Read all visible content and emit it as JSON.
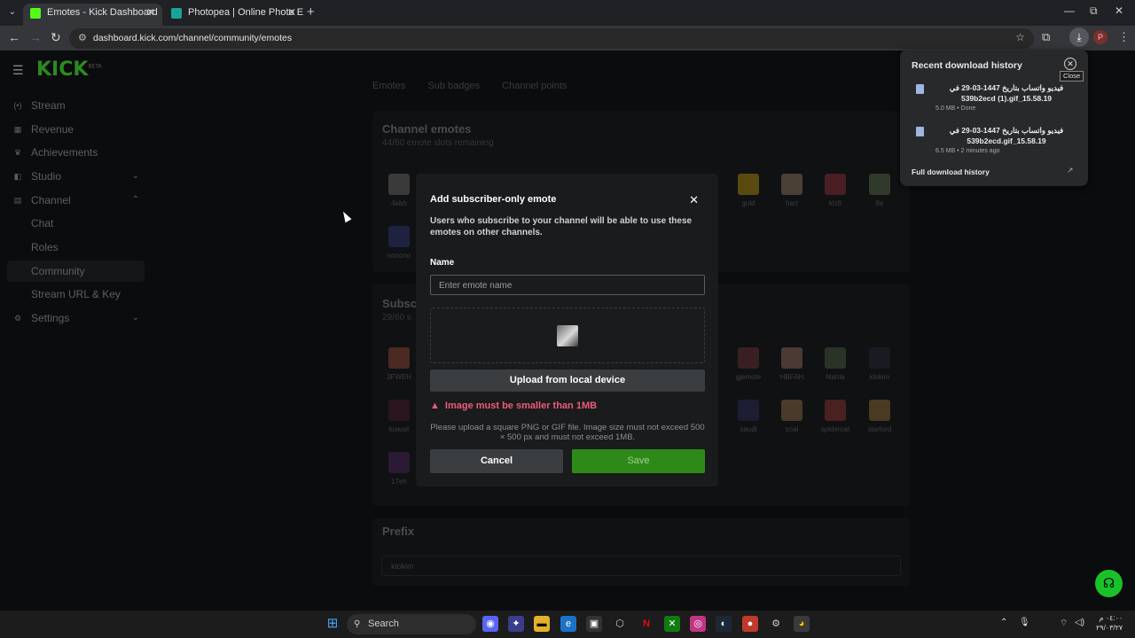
{
  "browser": {
    "tabs": [
      {
        "title": "Emotes - Kick Dashboard",
        "favicon_color": "#53fc18"
      },
      {
        "title": "Photopea | Online Photo Editor",
        "favicon_color": "#18a497"
      }
    ],
    "url": "dashboard.kick.com/channel/community/emotes"
  },
  "sidebar": {
    "logo": "KICK",
    "logo_badge": "BETA",
    "items": [
      {
        "label": "Stream",
        "icon": "broadcast-icon"
      },
      {
        "label": "Revenue",
        "icon": "revenue-icon"
      },
      {
        "label": "Achievements",
        "icon": "trophy-icon"
      },
      {
        "label": "Studio",
        "icon": "studio-icon"
      },
      {
        "label": "Channel",
        "icon": "channel-icon"
      },
      {
        "label": "Chat"
      },
      {
        "label": "Roles"
      },
      {
        "label": "Community"
      },
      {
        "label": "Stream URL & Key"
      },
      {
        "label": "Settings",
        "icon": "gear-icon"
      }
    ]
  },
  "main": {
    "tabs": [
      "Emotes",
      "Sub badges",
      "Channel points"
    ],
    "channel_emotes": {
      "title": "Channel emotes",
      "subtitle": "44/60 emote slots remaining",
      "emotes": [
        "4abh",
        "gold",
        "hart",
        "kiz8",
        "8e",
        "nonono"
      ]
    },
    "subscriber_emotes": {
      "title": "Subscr",
      "subtitle": "29/60 s",
      "emotes": [
        "3FWEH",
        "gjemote",
        "HBFAH",
        "hlahla",
        "klokim",
        "kuwait",
        "saudi",
        "soal",
        "spidercat",
        "starlord",
        "17eh"
      ]
    },
    "prefix": {
      "title": "Prefix",
      "value": "klokim"
    }
  },
  "modal": {
    "title": "Add subscriber-only emote",
    "description": "Users who subscribe to your channel will be able to use these emotes on other channels.",
    "name_label": "Name",
    "name_placeholder": "Enter emote name",
    "upload_label": "Upload from local device",
    "error": "Image must be smaller than 1MB",
    "hint": "Please upload a square PNG or GIF file. Image size must not exceed 500 × 500 px and must not exceed 1MB.",
    "cancel": "Cancel",
    "save": "Save"
  },
  "downloads": {
    "title": "Recent download history",
    "close_tooltip": "Close",
    "items": [
      {
        "name": "فيديو واتساب بتاريخ 1447-03-29 في 539b2ecd (1).gif_15.58.19",
        "status": "5.0 MB • Done"
      },
      {
        "name": "فيديو واتساب بتاريخ 1447-03-29 في 539b2ecd.gif_15.58.19",
        "status": "6.5 MB • 2 minutes ago"
      }
    ],
    "full_history": "Full download history"
  },
  "taskbar": {
    "search": "Search",
    "time": "٠٤:٠٠ م",
    "date": "٢٩/٠٣/٢٧"
  }
}
